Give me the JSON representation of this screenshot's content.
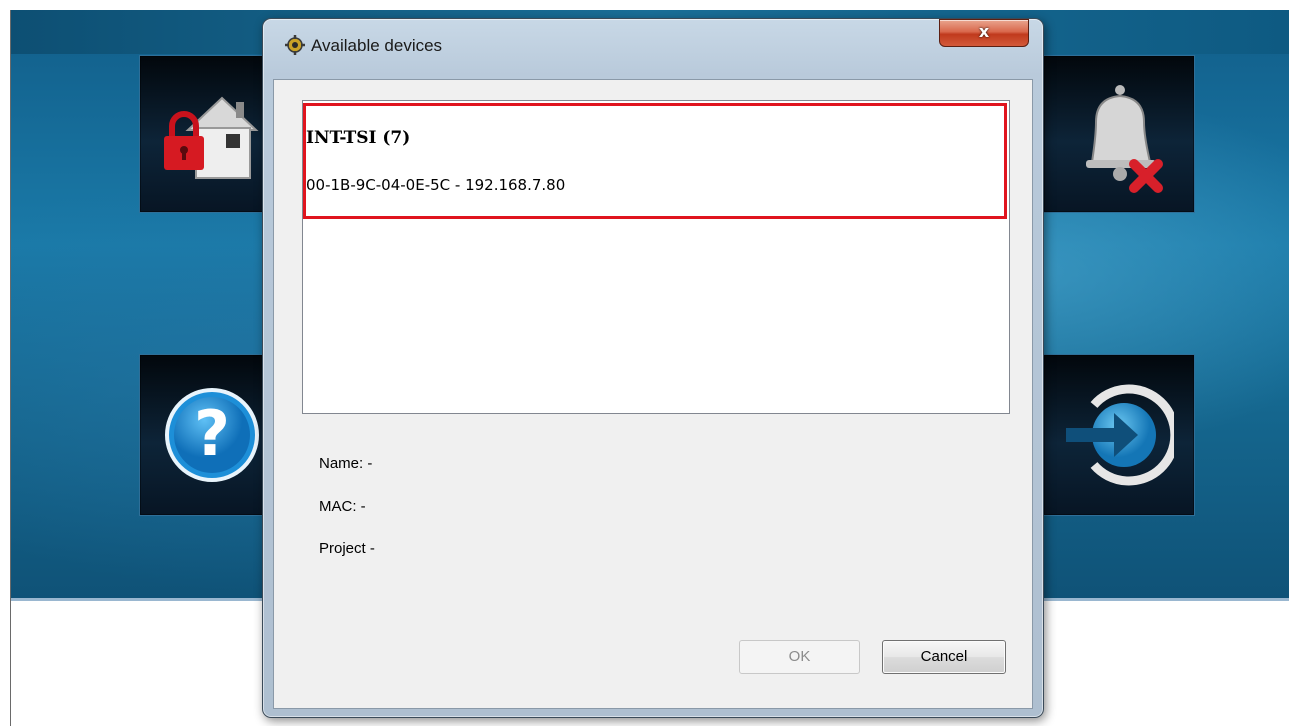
{
  "dialog": {
    "title": "Available devices",
    "close_label": "x",
    "device_list": [
      {
        "name": "INT-TSI (7)",
        "address": "00-1B-9C-04-0E-5C - 192.168.7.80"
      }
    ],
    "info": {
      "name_label": "Name: -",
      "mac_label": "MAC: -",
      "project_label": "Project -"
    },
    "buttons": {
      "ok": "OK",
      "cancel": "Cancel"
    }
  },
  "background_tiles": [
    {
      "icon": "house-lock-icon"
    },
    {
      "icon": "help-icon"
    },
    {
      "icon": "bell-cancel-icon"
    },
    {
      "icon": "exit-arrow-icon"
    }
  ],
  "colors": {
    "selection_border": "#e0141e",
    "background_blue": "#1a7aa8",
    "close_button": "#c03a1d"
  }
}
